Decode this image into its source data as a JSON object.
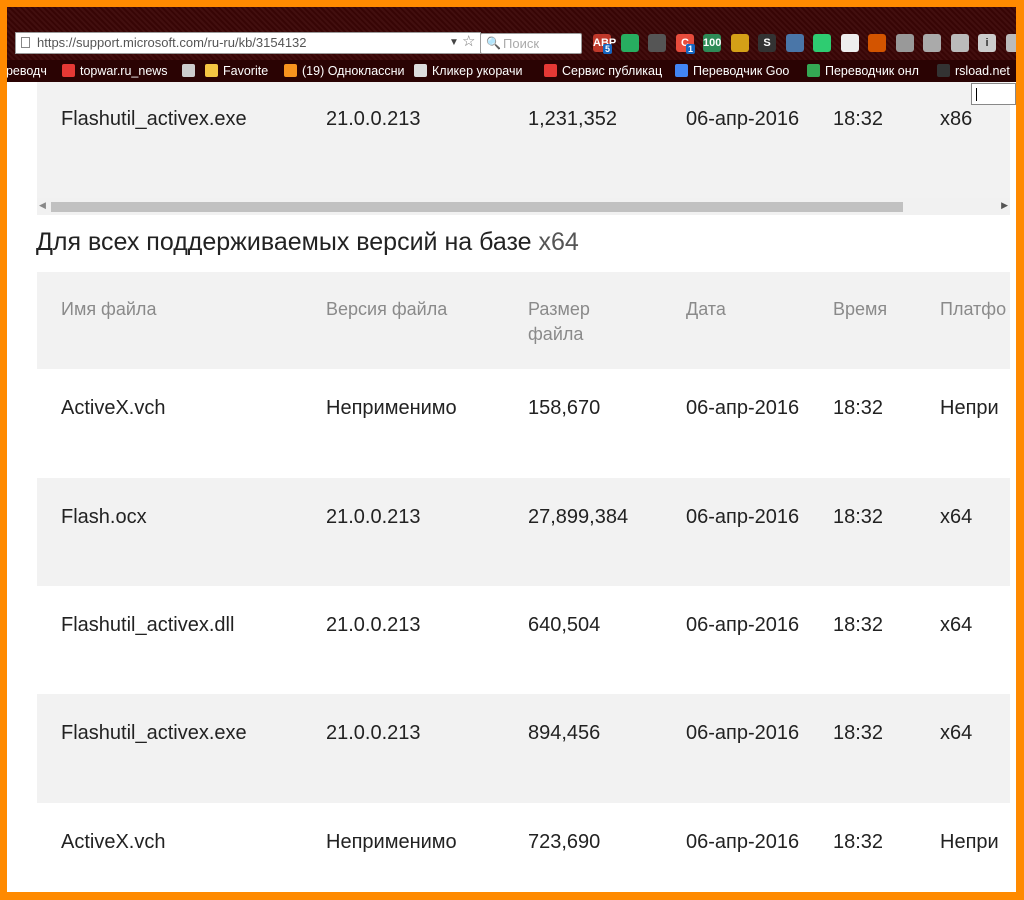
{
  "browser": {
    "url": "https://support.microsoft.com/ru-ru/kb/3154132",
    "search_placeholder": "Поиск",
    "extensions": [
      {
        "name": "adblock-plus",
        "label": "ABP",
        "badge": "5",
        "color": "#c0392b"
      },
      {
        "name": "refresh-circle",
        "label": "",
        "color": "#27ae60"
      },
      {
        "name": "gear",
        "label": "",
        "color": "#555555"
      },
      {
        "name": "c-extension",
        "label": "C",
        "badge": "1",
        "color": "#e74c3c"
      },
      {
        "name": "100-extension",
        "label": "100",
        "color": "#2e8b57"
      },
      {
        "name": "plug-extension",
        "label": "",
        "color": "#d4a017"
      },
      {
        "name": "s-extension",
        "label": "S",
        "color": "#333333"
      },
      {
        "name": "vk-extension",
        "label": "",
        "color": "#4a76a8"
      },
      {
        "name": "green-dot",
        "label": "",
        "color": "#2ecc71"
      },
      {
        "name": "chat-extension",
        "label": "",
        "color": "#eeeeee"
      },
      {
        "name": "cookie-extension",
        "label": "",
        "color": "#d35400"
      },
      {
        "name": "tools-extension",
        "label": "",
        "color": "#999999"
      },
      {
        "name": "g-extension",
        "label": "",
        "color": "#aaaaaa"
      },
      {
        "name": "doc-extension",
        "label": "",
        "color": "#bbbbbb"
      },
      {
        "name": "info-extension",
        "label": "i",
        "color": "#cccccc"
      },
      {
        "name": "menu-extension",
        "label": "",
        "color": "#bbbbbb"
      }
    ],
    "bookmarks": [
      {
        "label": "ереводч",
        "icon": "none"
      },
      {
        "label": "topwar.ru_news",
        "icon": "star",
        "color": "#e53935"
      },
      {
        "label": "",
        "icon": "page",
        "color": "#cccccc"
      },
      {
        "label": "Favorite",
        "icon": "folder",
        "color": "#f4c542"
      },
      {
        "label": "(19) Одноклассни",
        "icon": "ok",
        "color": "#f7931e"
      },
      {
        "label": "Кликер укорачи",
        "icon": "bolt",
        "color": "#dddddd"
      },
      {
        "label": "Сервис публикац",
        "icon": "s",
        "color": "#e53935"
      },
      {
        "label": "Переводчик Goo",
        "icon": "translate",
        "color": "#4285f4"
      },
      {
        "label": "Переводчик онл",
        "icon": "gplay",
        "color": "#34a853"
      },
      {
        "label": "rsload.net",
        "icon": "rs",
        "color": "#333333"
      }
    ]
  },
  "top_row": {
    "file": "Flashutil_activex.exe",
    "version": "21.0.0.213",
    "size": "1,231,352",
    "date": "06-апр-2016",
    "time": "18:32",
    "platform": "x86"
  },
  "section": {
    "title": "Для всех поддерживаемых версий на базе",
    "arch": "x64"
  },
  "table": {
    "headers": [
      "Имя файла",
      "Версия файла",
      "Размер файла",
      "Дата",
      "Время",
      "Платфо"
    ],
    "rows": [
      {
        "file": "ActiveX.vch",
        "version": "Неприменимо",
        "size": "158,670",
        "date": "06-апр-2016",
        "time": "18:32",
        "platform": "Непри"
      },
      {
        "file": "Flash.ocx",
        "version": "21.0.0.213",
        "size": "27,899,384",
        "date": "06-апр-2016",
        "time": "18:32",
        "platform": "x64"
      },
      {
        "file": "Flashutil_activex.dll",
        "version": "21.0.0.213",
        "size": "640,504",
        "date": "06-апр-2016",
        "time": "18:32",
        "platform": "x64"
      },
      {
        "file": "Flashutil_activex.exe",
        "version": "21.0.0.213",
        "size": "894,456",
        "date": "06-апр-2016",
        "time": "18:32",
        "platform": "x64"
      },
      {
        "file": "ActiveX.vch",
        "version": "Неприменимо",
        "size": "723,690",
        "date": "06-апр-2016",
        "time": "18:32",
        "platform": "Непри"
      }
    ]
  }
}
